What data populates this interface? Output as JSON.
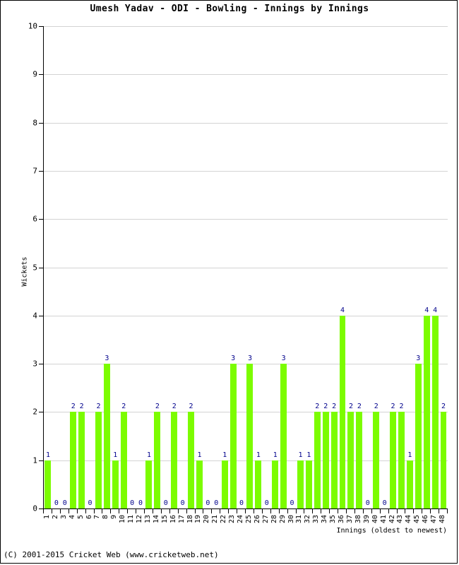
{
  "chart_data": {
    "type": "bar",
    "title": "Umesh Yadav - ODI - Bowling - Innings by Innings",
    "xlabel": "Innings (oldest to newest)",
    "ylabel": "Wickets",
    "ylim": [
      0,
      10
    ],
    "ytick_step": 1,
    "yticks": [
      0,
      1,
      2,
      3,
      4,
      5,
      6,
      7,
      8,
      9,
      10
    ],
    "grid": true,
    "legend": null,
    "bar_color": "#7cfc00",
    "label_color": "#00008b",
    "axis_color": "#000000",
    "grid_color": "#d3d3d3",
    "categories": [
      1,
      2,
      3,
      4,
      5,
      6,
      7,
      8,
      9,
      10,
      11,
      12,
      13,
      14,
      15,
      16,
      17,
      18,
      19,
      20,
      21,
      22,
      23,
      24,
      25,
      26,
      27,
      28,
      29,
      30,
      31,
      32,
      33,
      34,
      35,
      36,
      37,
      38,
      39,
      40,
      41,
      42,
      43,
      44,
      45,
      46,
      47,
      48
    ],
    "values": [
      1,
      0,
      0,
      2,
      2,
      0,
      2,
      3,
      1,
      2,
      0,
      0,
      1,
      2,
      0,
      2,
      0,
      2,
      1,
      0,
      0,
      1,
      3,
      0,
      3,
      1,
      0,
      1,
      3,
      0,
      1,
      1,
      2,
      2,
      2,
      4,
      2,
      2,
      0,
      2,
      0,
      2,
      2,
      1,
      3,
      4,
      4,
      2
    ]
  },
  "footer": {
    "copyright": "(C) 2001-2015 Cricket Web (www.cricketweb.net)"
  }
}
